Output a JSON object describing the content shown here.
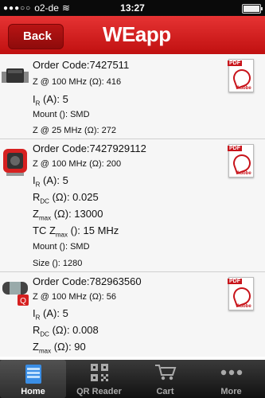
{
  "status": {
    "carrier": "o2-de",
    "time": "13:27"
  },
  "nav": {
    "back_label": "Back",
    "title": "WEapp"
  },
  "items": [
    {
      "code": "Order Code:7427511",
      "lines": [
        "Z @ 100 MHz (Ω): 416",
        "(A): 5",
        "Mount (): SMD",
        "Z @ 25 MHz (Ω): 272"
      ],
      "pdf": "PDF",
      "adobe": "Adobe"
    },
    {
      "code": "Order Code:7427929112",
      "lines": [
        "Z @ 100 MHz (Ω): 200",
        "(A): 5",
        "(Ω): 0.025",
        "(Ω): 13000",
        "(): 15 MHz",
        "Mount (): SMD",
        "Size (): 1280"
      ],
      "pdf": "PDF",
      "adobe": "Adobe"
    },
    {
      "code": "Order Code:782963560",
      "lines": [
        "Z @ 100 MHz (Ω): 56",
        "(A): 5",
        "(Ω): 0.008",
        "(Ω): 90"
      ],
      "pdf": "PDF",
      "adobe": "Adobe"
    }
  ],
  "symbols": {
    "ir": "I",
    "ir_sub": "R",
    "rdc": "R",
    "rdc_sub": "DC",
    "zmax": "Z",
    "zmax_sub": "max",
    "tc": "TC Z",
    "tc_sub": "max"
  },
  "tabs": [
    {
      "label": "Home",
      "icon": "home-icon"
    },
    {
      "label": "QR Reader",
      "icon": "qr-code-icon"
    },
    {
      "label": "Cart",
      "icon": "cart-icon"
    },
    {
      "label": "More",
      "icon": "more-icon"
    }
  ],
  "colors": {
    "brand_red": "#d81e1e",
    "tabbar": "#1a1a1a"
  }
}
